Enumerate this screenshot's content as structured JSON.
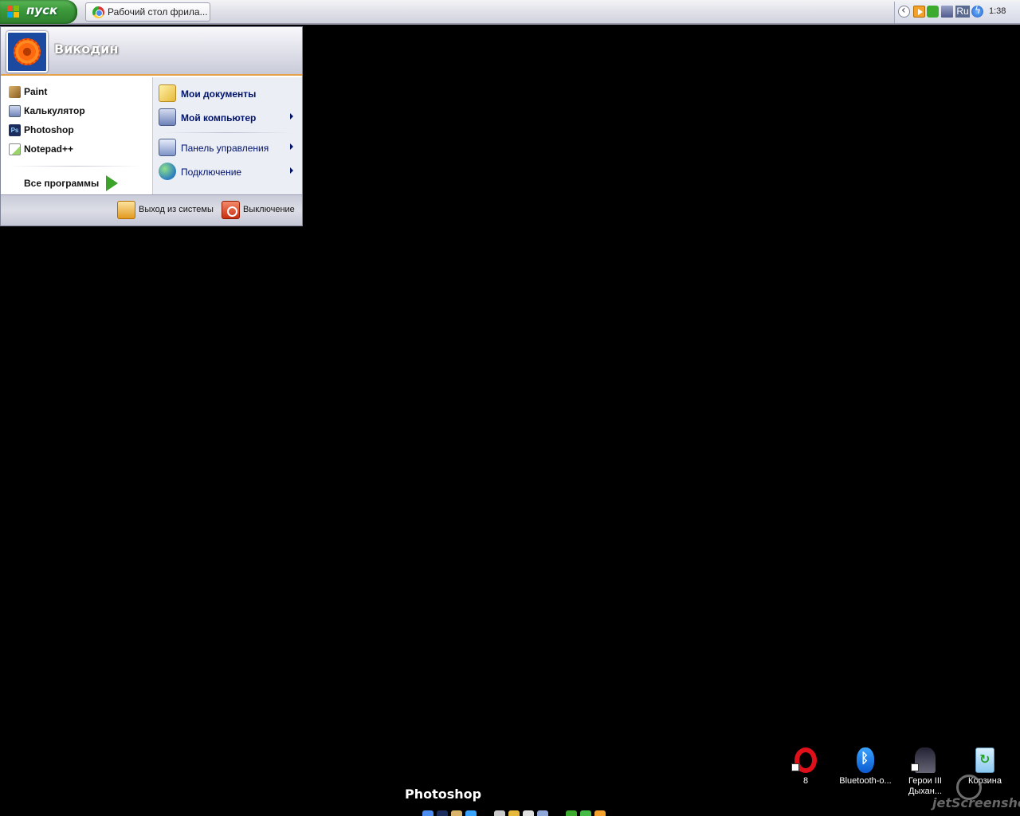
{
  "taskbar": {
    "start_label": "пуск",
    "task_item_label": "Рабочий стол фрила...",
    "tray": {
      "language": "Ru",
      "clock": "1:38"
    }
  },
  "start_menu": {
    "username": "Викодин",
    "programs": [
      "Paint",
      "Калькулятор",
      "Photoshop",
      "Notepad++"
    ],
    "all_programs": "Все программы",
    "places": [
      {
        "label": "Мои документы",
        "bold": true,
        "submenu": false
      },
      {
        "label": "Мой компьютер",
        "bold": true,
        "submenu": true
      },
      {
        "label": "Панель управления",
        "bold": false,
        "submenu": true
      },
      {
        "label": "Подключение",
        "bold": false,
        "submenu": true
      }
    ],
    "footer": {
      "logout": "Выход из системы",
      "shutdown": "Выключение"
    },
    "photoshop_icon_text": "Ps"
  },
  "desktop_icons": [
    {
      "label": "8"
    },
    {
      "label": "Bluetooth-о..."
    },
    {
      "label": "Герои III Дыхан..."
    },
    {
      "label": "Корзина"
    }
  ],
  "dock": {
    "title": "Photoshop"
  },
  "watermark": {
    "text": "jetScreenshot"
  },
  "colors": {
    "start_green": "#3d9a3b",
    "menu_accent": "#e6a24a",
    "desktop": "#000000"
  }
}
